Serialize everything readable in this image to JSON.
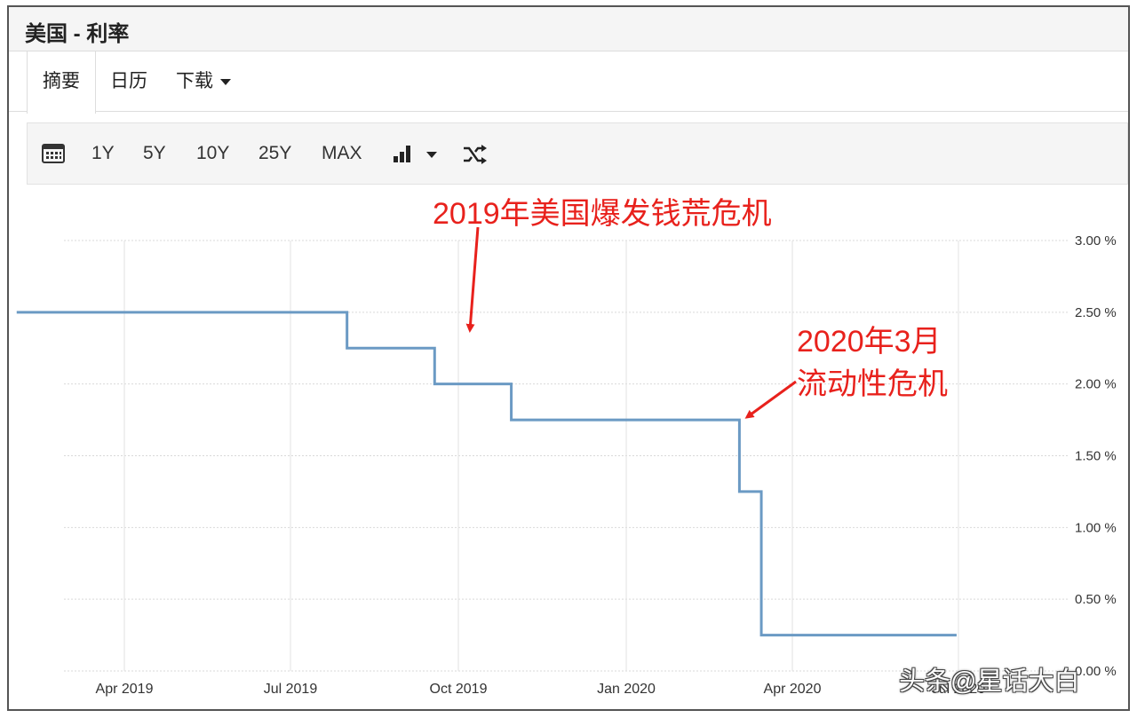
{
  "title": "美国 - 利率",
  "tabs": [
    {
      "label": "摘要",
      "active": true
    },
    {
      "label": "日历",
      "active": false
    },
    {
      "label": "下载",
      "active": false
    }
  ],
  "toolbar": {
    "ranges": [
      "1Y",
      "5Y",
      "10Y",
      "25Y",
      "MAX"
    ],
    "icons": [
      "calendar-icon",
      "bar-chart-icon",
      "chevron-down-icon",
      "shuffle-icon"
    ]
  },
  "chart_data": {
    "type": "line",
    "step": true,
    "color": "#6b9ac4",
    "x": [
      "2019-02-01",
      "2019-08-01",
      "2019-09-18",
      "2019-10-30",
      "2020-03-03",
      "2020-03-15",
      "2020-06-30"
    ],
    "y": [
      2.5,
      2.25,
      2.0,
      1.75,
      1.25,
      0.25,
      0.25
    ],
    "ylim": [
      0,
      3.0
    ],
    "yticks": [
      "3.00 %",
      "2.50 %",
      "2.00 %",
      "1.50 %",
      "1.00 %",
      "0.50 %",
      "0.00 %"
    ],
    "xticks": [
      "Apr 2019",
      "Jul 2019",
      "Oct 2019",
      "Jan 2020",
      "Apr 2020",
      "Jul 2020"
    ],
    "grid": true,
    "y_axis_position": "right",
    "annotations": [
      {
        "text": "2019年美国爆发钱荒危机",
        "color": "#e8211c"
      },
      {
        "text": "2020年3月",
        "color": "#e8211c"
      },
      {
        "text": "流动性危机",
        "color": "#e8211c"
      }
    ]
  },
  "watermark": "头条@星话大白"
}
